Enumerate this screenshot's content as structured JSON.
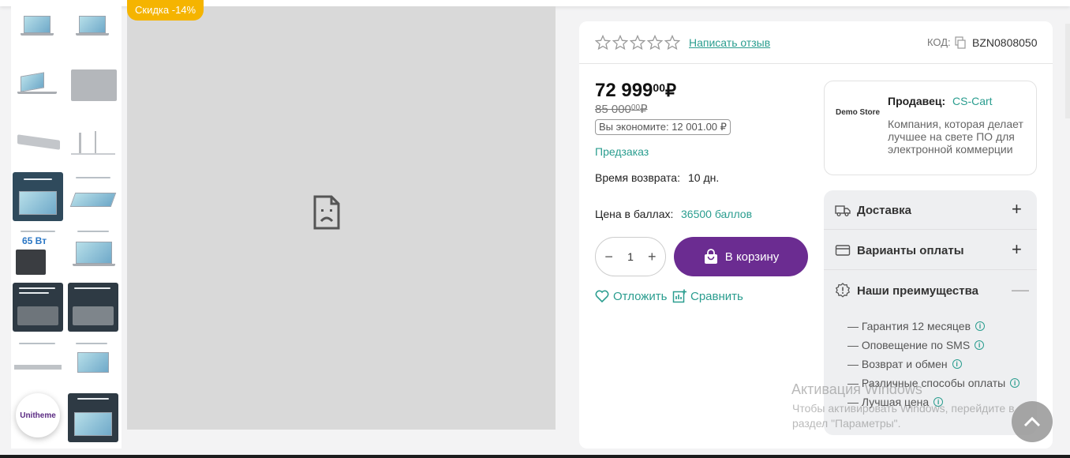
{
  "badge": {
    "discount": "Скидка -14%"
  },
  "thumbnails": [
    {
      "name": "thumb-1"
    },
    {
      "name": "thumb-2"
    },
    {
      "name": "thumb-3"
    },
    {
      "name": "thumb-4"
    },
    {
      "name": "thumb-5"
    },
    {
      "name": "thumb-6"
    },
    {
      "name": "thumb-7"
    },
    {
      "name": "thumb-8"
    },
    {
      "name": "thumb-9"
    },
    {
      "name": "thumb-10"
    },
    {
      "name": "thumb-11"
    },
    {
      "name": "thumb-12"
    },
    {
      "name": "thumb-13"
    },
    {
      "name": "thumb-14"
    },
    {
      "name": "thumb-15"
    }
  ],
  "thumb_text": {
    "watts": "65 Вт"
  },
  "logo": {
    "text": "Unitheme"
  },
  "rating": {
    "stars": 0,
    "max": 5,
    "review_link": "Написать отзыв"
  },
  "code": {
    "label": "КОД:",
    "value": "BZN0808050"
  },
  "price": {
    "main": "72 999",
    "cents": "00",
    "currency": "₽"
  },
  "old_price": {
    "main": "85 000",
    "cents": "00",
    "currency": "₽"
  },
  "savings": "Вы экономите: 12 001.00 ₽",
  "availability": "Предзаказ",
  "return": {
    "label": "Время возврата:",
    "value": "10 дн."
  },
  "points": {
    "label": "Цена в баллах:",
    "value": "36500 баллов"
  },
  "quantity": {
    "value": "1",
    "minus": "−",
    "plus": "+"
  },
  "cart_button": "В корзину",
  "wishlist": "Отложить",
  "compare": "Сравнить",
  "vendor": {
    "logo": "Demo Store",
    "label": "Продавец:",
    "name": "CS-Cart",
    "description": "Компания, которая делает лучшее на свете ПО для электронной коммерции"
  },
  "accordion": [
    {
      "title": "Доставка",
      "icon": "truck-icon",
      "state": "+"
    },
    {
      "title": "Варианты оплаты",
      "icon": "card-icon",
      "state": "+"
    },
    {
      "title": "Наши преимущества",
      "icon": "badge-icon",
      "state": "—"
    }
  ],
  "advantages": [
    "— Гарантия 12 месяцев",
    "— Оповещение по SMS",
    "— Возврат и обмен",
    "— Различные способы оплаты",
    "— Лучшая цена"
  ],
  "watermark": {
    "title": "Активация Windows",
    "subtitle": "Чтобы активировать Windows, перейдите в раздел \"Параметры\"."
  },
  "colors": {
    "accent": "#6b2c91",
    "link": "#2a9d8f",
    "badge": "#f5b400"
  }
}
